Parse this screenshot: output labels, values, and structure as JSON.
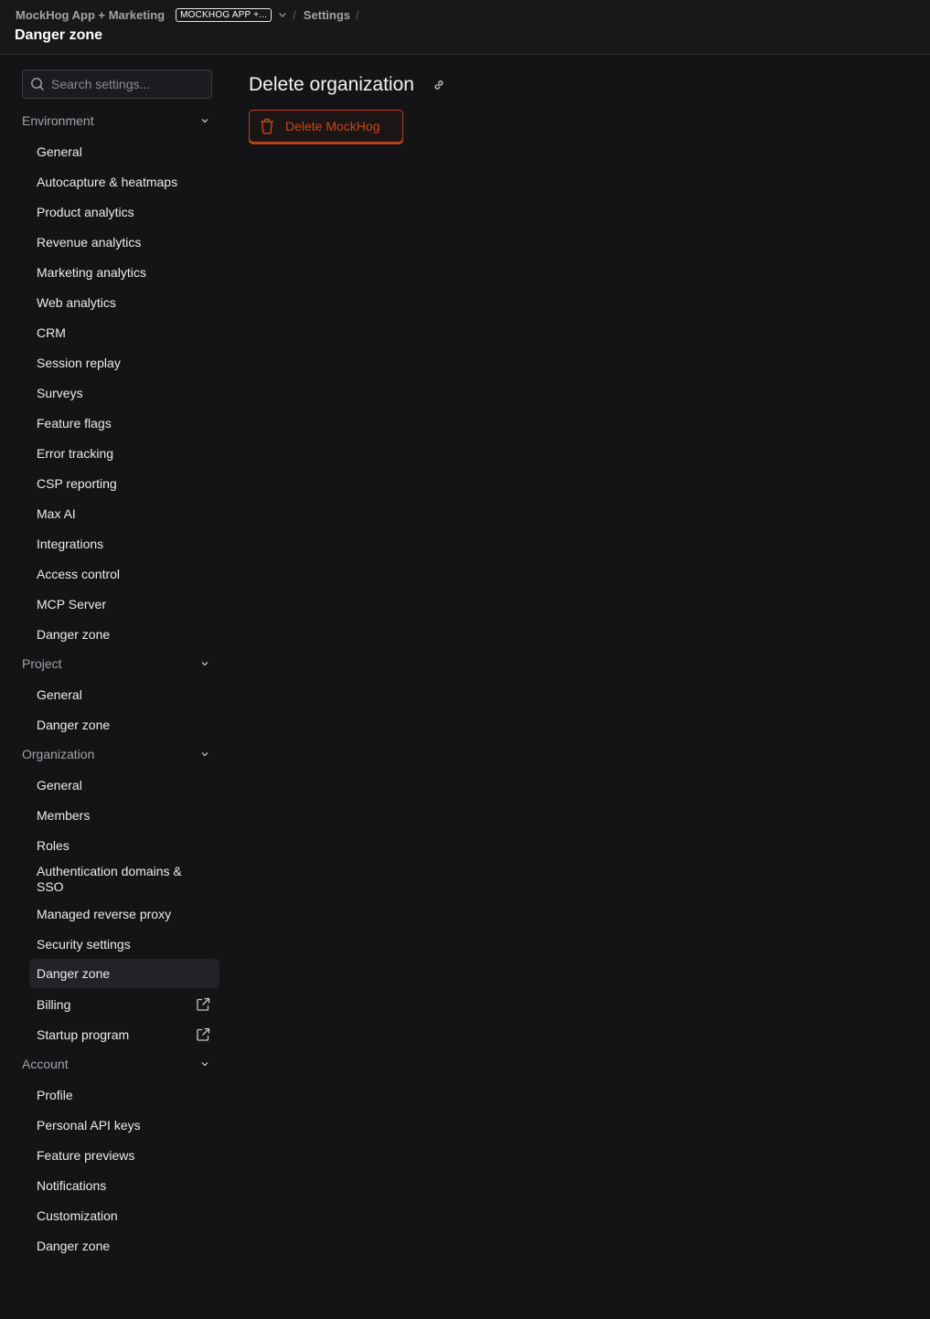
{
  "breadcrumb": {
    "org": "MockHog App + Marketing",
    "org_badge": "MOCKHOG APP +...",
    "separator": "/",
    "settings": "Settings",
    "current": "Danger zone"
  },
  "search": {
    "placeholder": "Search settings..."
  },
  "sidebar": {
    "environment": {
      "label": "Environment",
      "items": [
        "General",
        "Autocapture & heatmaps",
        "Product analytics",
        "Revenue analytics",
        "Marketing analytics",
        "Web analytics",
        "CRM",
        "Session replay",
        "Surveys",
        "Feature flags",
        "Error tracking",
        "CSP reporting",
        "Max AI",
        "Integrations",
        "Access control",
        "MCP Server",
        "Danger zone"
      ]
    },
    "project": {
      "label": "Project",
      "items": [
        "General",
        "Danger zone"
      ]
    },
    "organization": {
      "label": "Organization",
      "items": [
        "General",
        "Members",
        "Roles",
        "Authentication domains & SSO",
        "Managed reverse proxy",
        "Security settings",
        "Danger zone",
        "Billing",
        "Startup program"
      ]
    },
    "account": {
      "label": "Account",
      "items": [
        "Profile",
        "Personal API keys",
        "Feature previews",
        "Notifications",
        "Customization",
        "Danger zone"
      ]
    }
  },
  "main": {
    "title": "Delete organization",
    "delete_button": "Delete MockHog"
  },
  "colors": {
    "danger": "#c8461c",
    "background": "#141417"
  }
}
